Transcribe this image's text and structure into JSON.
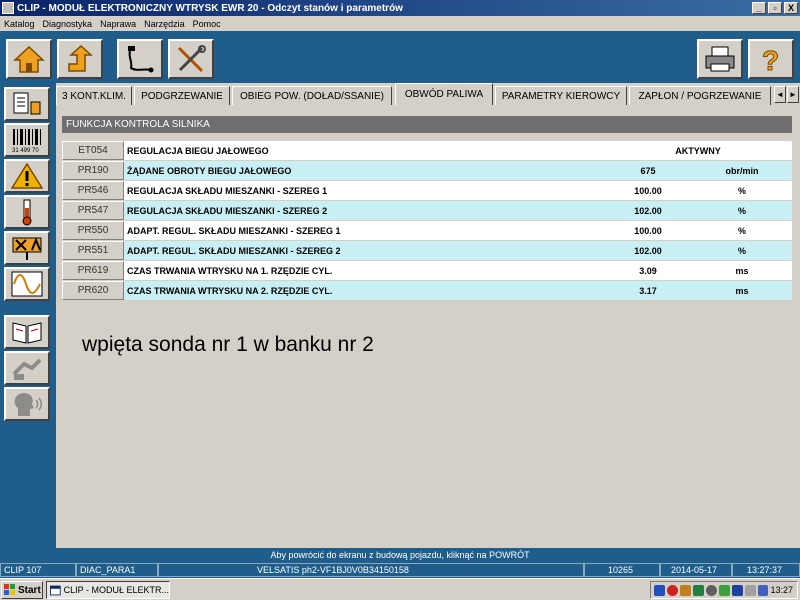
{
  "window": {
    "title": "CLIP - MODUŁ ELEKTRONICZNY WTRYSK EWR 20 - Odczyt stanów i parametrów",
    "min_label": "_",
    "restore_label": "▫",
    "close_label": "X"
  },
  "menu": [
    "Katalog",
    "Diagnostyka",
    "Naprawa",
    "Narzędzia",
    "Pomoc"
  ],
  "sidebar": {
    "barcode_number": "31 499 70"
  },
  "tabs": [
    {
      "label": "3 KONT.KLIM."
    },
    {
      "label": "PODGRZEWANIE"
    },
    {
      "label": "OBIEG POW. (DOŁAD/SSANIE)"
    },
    {
      "label": "OBWÓD PALIWA",
      "active": true
    },
    {
      "label": "PARAMETRY KIEROWCY"
    },
    {
      "label": "ZAPŁON / POGRZEWANIE"
    }
  ],
  "tab_scroll": {
    "left": "◄",
    "right": "►"
  },
  "section_title": "FUNKCJA KONTROLA SILNIKA",
  "rows": [
    {
      "code": "ET054",
      "desc": "REGULACJA BIEGU JAŁOWEGO",
      "value": "AKTYWNY",
      "unit": ""
    },
    {
      "code": "PR190",
      "desc": "ŻĄDANE OBROTY BIEGU JAŁOWEGO",
      "value": "675",
      "unit": "obr/min"
    },
    {
      "code": "PR546",
      "desc": "REGULACJA SKŁADU MIESZANKI - SZEREG 1",
      "value": "100.00",
      "unit": "%"
    },
    {
      "code": "PR547",
      "desc": "REGULACJA SKŁADU MIESZANKI - SZEREG 2",
      "value": "102.00",
      "unit": "%"
    },
    {
      "code": "PR550",
      "desc": "ADAPT. REGUL. SKŁADU MIESZANKI - SZEREG 1",
      "value": "100.00",
      "unit": "%"
    },
    {
      "code": "PR551",
      "desc": "ADAPT. REGUL. SKŁADU MIESZANKI - SZEREG 2",
      "value": "102.00",
      "unit": "%"
    },
    {
      "code": "PR619",
      "desc": "CZAS TRWANIA WTRYSKU NA 1. RZĘDZIE CYL.",
      "value": "3.09",
      "unit": "ms"
    },
    {
      "code": "PR620",
      "desc": "CZAS TRWANIA WTRYSKU NA 2. RZĘDZIE CYL.",
      "value": "3.17",
      "unit": "ms"
    }
  ],
  "annotation": "wpięta sonda nr 1 w banku nr 2",
  "hint": "Aby powrócić do ekranu z budową pojazdu, kliknąć na POWRÓT",
  "status": {
    "clip": "CLIP 107",
    "diag": "DIAC_PARA1",
    "vehicle": "VELSATIS ph2-VF1BJ0V0B34150158",
    "code": "10265",
    "date": "2014-05-17",
    "time": "13:27:37"
  },
  "taskbar": {
    "start": "Start",
    "task": "CLIP - MODUŁ ELEKTR...",
    "clock": "13:27"
  },
  "colors": {
    "blue_bg": "#1f5e8a",
    "row_cyan": "#c8f0f4",
    "warning": "#f0b000",
    "home_orange": "#f0a020"
  }
}
